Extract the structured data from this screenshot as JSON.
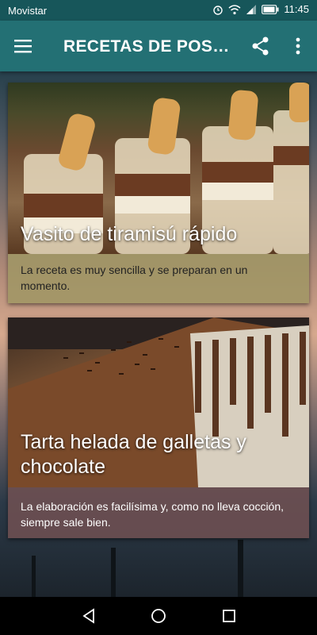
{
  "status_bar": {
    "carrier": "Movistar",
    "time": "11:45"
  },
  "app_bar": {
    "title": "RECETAS DE POSTRES"
  },
  "cards": [
    {
      "title": "Vasito de tiramisú rápido",
      "description": "La receta es muy sencilla y se preparan en un momento."
    },
    {
      "title": "Tarta helada de galletas y chocolate",
      "description": "La elaboración es facilísima y, como no lleva cocción, siempre sale bien."
    }
  ],
  "colors": {
    "app_bar": "#237074",
    "status_bar": "#17565a",
    "card1_caption": "#a0966a",
    "card2_caption": "#6e5052"
  },
  "icons": [
    "alarm-icon",
    "wifi-icon",
    "signal-icon",
    "battery-icon",
    "menu-icon",
    "share-icon",
    "more-vert-icon",
    "back-icon",
    "home-icon",
    "recents-icon"
  ]
}
